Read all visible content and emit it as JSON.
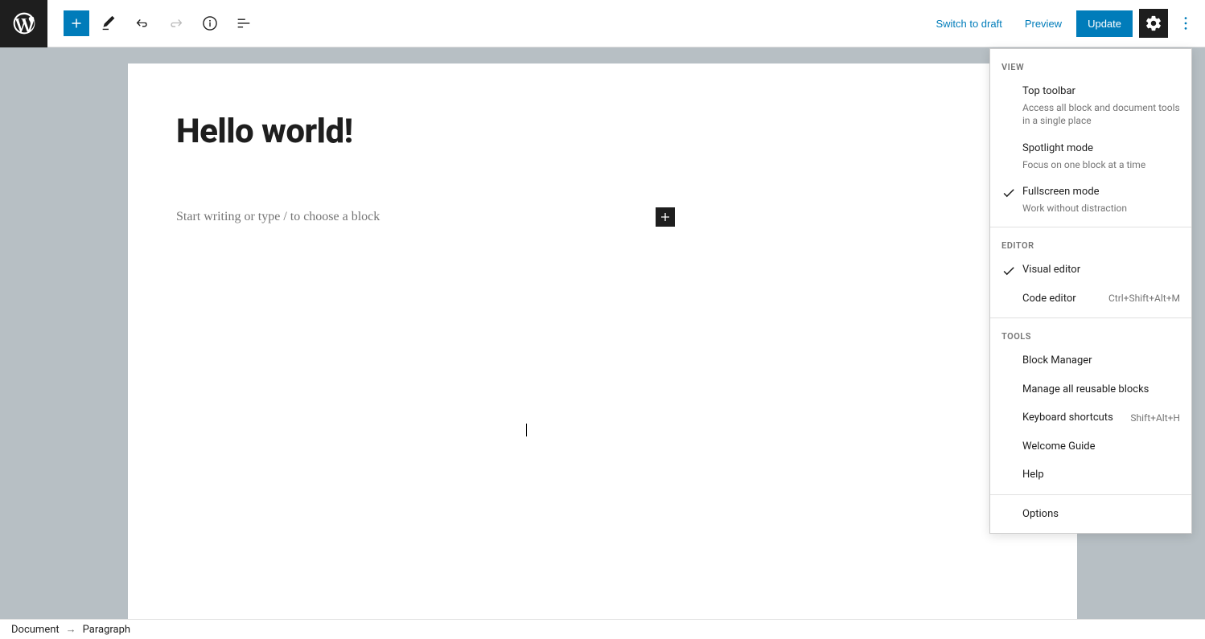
{
  "header": {
    "switch_draft": "Switch to draft",
    "preview": "Preview",
    "update": "Update"
  },
  "post": {
    "title": "Hello world!",
    "placeholder": "Start writing or type / to choose a block"
  },
  "menu": {
    "sections": {
      "view": "View",
      "editor": "Editor",
      "tools": "Tools"
    },
    "view": [
      {
        "title": "Top toolbar",
        "desc": "Access all block and document tools in a single place",
        "checked": false
      },
      {
        "title": "Spotlight mode",
        "desc": "Focus on one block at a time",
        "checked": false
      },
      {
        "title": "Fullscreen mode",
        "desc": "Work without distraction",
        "checked": true
      }
    ],
    "editor": [
      {
        "title": "Visual editor",
        "checked": true,
        "shortcut": ""
      },
      {
        "title": "Code editor",
        "checked": false,
        "shortcut": "Ctrl+Shift+Alt+M"
      }
    ],
    "tools": [
      {
        "title": "Block Manager",
        "shortcut": ""
      },
      {
        "title": "Manage all reusable blocks",
        "shortcut": ""
      },
      {
        "title": "Keyboard shortcuts",
        "shortcut": "Shift+Alt+H"
      },
      {
        "title": "Welcome Guide",
        "shortcut": ""
      },
      {
        "title": "Help",
        "shortcut": ""
      }
    ],
    "options": "Options"
  },
  "breadcrumb": {
    "document": "Document",
    "paragraph": "Paragraph"
  }
}
